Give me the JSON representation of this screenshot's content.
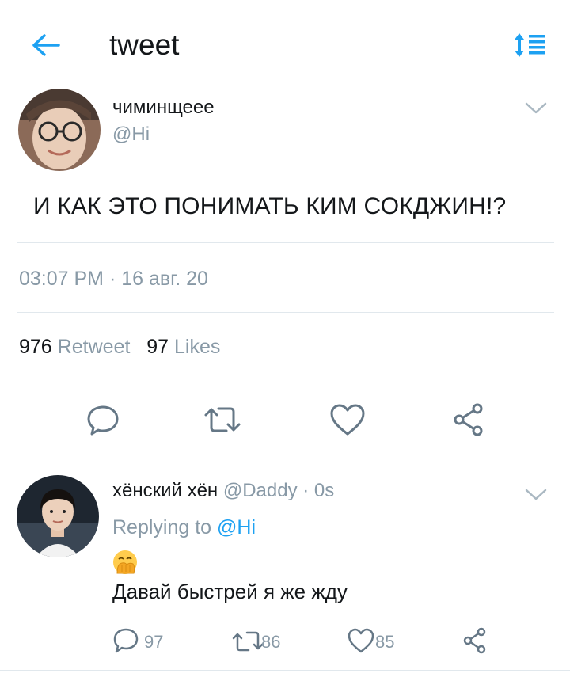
{
  "header": {
    "title": "tweet",
    "back_icon": "arrow-left-icon",
    "sort_icon": "sort-list-icon",
    "accent": "#1da1f2"
  },
  "tweet": {
    "display_name": "чиминщеее",
    "handle": "@Hi",
    "text": "И КАК ЭТО ПОНИМАТЬ КИМ СОКДЖИН!?",
    "timestamp": "03:07 PM · 16 авг. 20",
    "retweet_count": "976",
    "retweet_label": "Retweet",
    "like_count": "97",
    "like_label": "Likes",
    "actions": [
      "reply-icon",
      "retweet-icon",
      "heart-icon",
      "share-icon"
    ]
  },
  "reply": {
    "display_name": "хёнский хён",
    "handle_time": "@Daddy · 0s",
    "replying_prefix": "Replying to",
    "replying_to": "@Hi",
    "emoji": "hand-over-mouth-emoji",
    "text": "Давай быстрей я же жду",
    "reply_count": "97",
    "retweet_count": "86",
    "like_count": "85"
  }
}
